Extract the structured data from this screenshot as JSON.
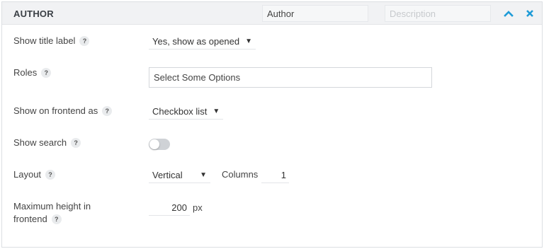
{
  "header": {
    "title": "AUTHOR",
    "name_value": "Author",
    "description_placeholder": "Description"
  },
  "fields": {
    "show_title_label": {
      "label": "Show title label",
      "value": "Yes, show as opened"
    },
    "roles": {
      "label": "Roles",
      "placeholder": "Select Some Options"
    },
    "show_on_frontend": {
      "label": "Show on frontend as",
      "value": "Checkbox list"
    },
    "show_search": {
      "label": "Show search",
      "enabled": false
    },
    "layout": {
      "label": "Layout",
      "value": "Vertical",
      "columns_label": "Columns",
      "columns_value": "1"
    },
    "max_height": {
      "label_line1": "Maximum height in",
      "label_line2": "frontend",
      "value": "200",
      "unit": "px"
    }
  },
  "help_glyph": "?",
  "caret_glyph": "▼",
  "colors": {
    "accent": "#1e9bd7",
    "toggle_off": "#cfd2d6"
  },
  "icons": {
    "collapse": "chevron-up-icon",
    "close": "close-icon",
    "help": "help-icon",
    "dropdown": "caret-down-icon"
  }
}
